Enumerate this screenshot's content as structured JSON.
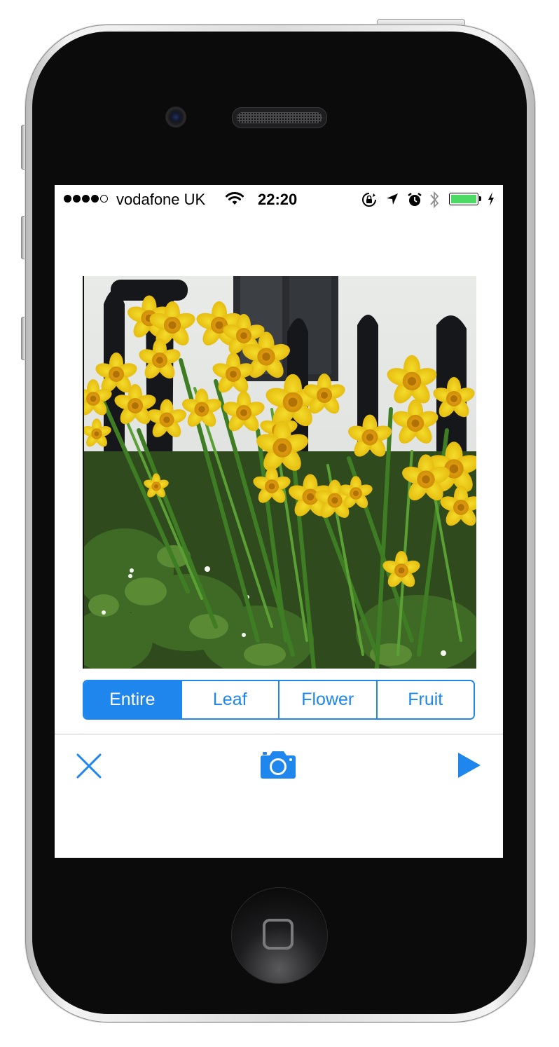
{
  "status_bar": {
    "carrier": "vodafone UK",
    "time": "22:20",
    "signal_bars_filled": 4,
    "signal_bars_total": 5,
    "battery_level": 1.0,
    "battery_color": "#4cd964",
    "icons": [
      "wifi-icon",
      "rotation-lock-icon",
      "location-icon",
      "alarm-icon",
      "bluetooth-icon",
      "battery-icon",
      "charging-icon"
    ]
  },
  "photo": {
    "subject": "daffodils"
  },
  "segmented_control": {
    "selected": "Entire",
    "segments": [
      {
        "label": "Entire"
      },
      {
        "label": "Leaf"
      },
      {
        "label": "Flower"
      },
      {
        "label": "Fruit"
      }
    ]
  },
  "toolbar": {
    "left_icon": "close-icon",
    "center_icon": "camera-icon",
    "right_icon": "play-icon"
  },
  "colors": {
    "accent": "#1f86ee",
    "screen_background": "#ffffff",
    "phone_body": "#0b0b0c"
  }
}
